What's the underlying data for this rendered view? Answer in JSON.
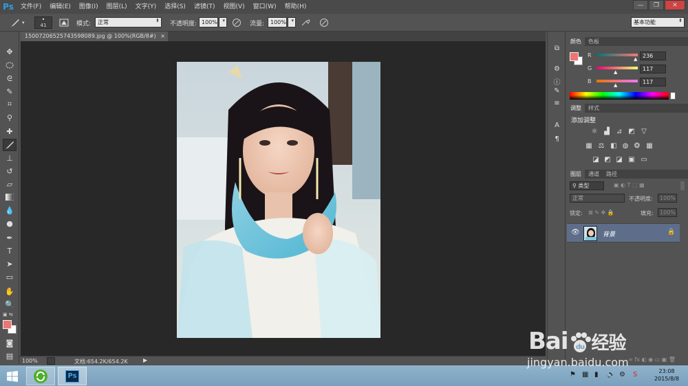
{
  "app": {
    "logo": "Ps"
  },
  "menu": [
    "文件(F)",
    "编辑(E)",
    "图像(I)",
    "图层(L)",
    "文字(Y)",
    "选择(S)",
    "滤镜(T)",
    "视图(V)",
    "窗口(W)",
    "帮助(H)"
  ],
  "window_controls": [
    "—",
    "❐",
    "✕"
  ],
  "options": {
    "brush_size": "41",
    "mode_label": "模式:",
    "mode_value": "正常",
    "opacity_label": "不透明度:",
    "opacity_value": "100%",
    "flow_label": "流量:",
    "flow_value": "100%",
    "workspace": "基本功能"
  },
  "document": {
    "tab_title": "15007206525743598089.jpg @ 100%(RGB/8#)",
    "tab_close": "×",
    "zoom": "100%",
    "doc_info": "文档:654.2K/654.2K"
  },
  "color_panel": {
    "tabs": [
      "颜色",
      "色板"
    ],
    "channels": [
      {
        "label": "R",
        "value": "236"
      },
      {
        "label": "G",
        "value": "117"
      },
      {
        "label": "B",
        "value": "117"
      }
    ],
    "foreground": "#ec7575"
  },
  "adjust_panel": {
    "tabs": [
      "调整",
      "样式"
    ],
    "heading": "添加调整"
  },
  "layers_panel": {
    "tabs": [
      "图层",
      "通道",
      "路径"
    ],
    "filter_kind": "类型",
    "blend_mode": "正常",
    "opacity_label": "不透明度:",
    "opacity_value": "100%",
    "lock_label": "锁定:",
    "fill_label": "填充:",
    "fill_value": "100%",
    "layers": [
      {
        "name": "背景"
      }
    ]
  },
  "taskbar": {
    "time": "23:08",
    "date": "2015/8/8",
    "ps_label": "Ps"
  },
  "watermark": {
    "brand": "Bai",
    "brand_suffix": "经验",
    "url": "jingyan.baidu.com"
  }
}
